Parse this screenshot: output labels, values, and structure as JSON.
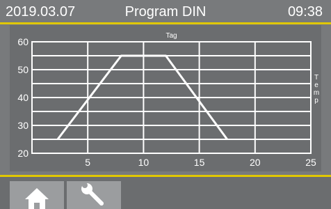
{
  "header": {
    "date": "2019.03.07",
    "title": "Program DIN",
    "time": "09:38"
  },
  "toolbar": {
    "home_icon": "home-icon",
    "tools_icon": "wrench-icon"
  },
  "colors": {
    "accent": "#e0c700",
    "background": "#787a7c",
    "panel": "#6b6d6f",
    "line": "#ffffff"
  },
  "chart_data": {
    "type": "line",
    "title": "Tag",
    "xlabel": "",
    "ylabel": "T e m p",
    "xlim": [
      0,
      25
    ],
    "ylim": [
      20,
      60
    ],
    "xticks": [
      5,
      10,
      15,
      20,
      25
    ],
    "yticks": [
      20,
      30,
      40,
      50,
      60
    ],
    "grid": true,
    "series": [
      {
        "x": [
          2.3,
          8.0,
          12.0,
          17.5
        ],
        "y": [
          25,
          55,
          55,
          25
        ]
      }
    ]
  }
}
